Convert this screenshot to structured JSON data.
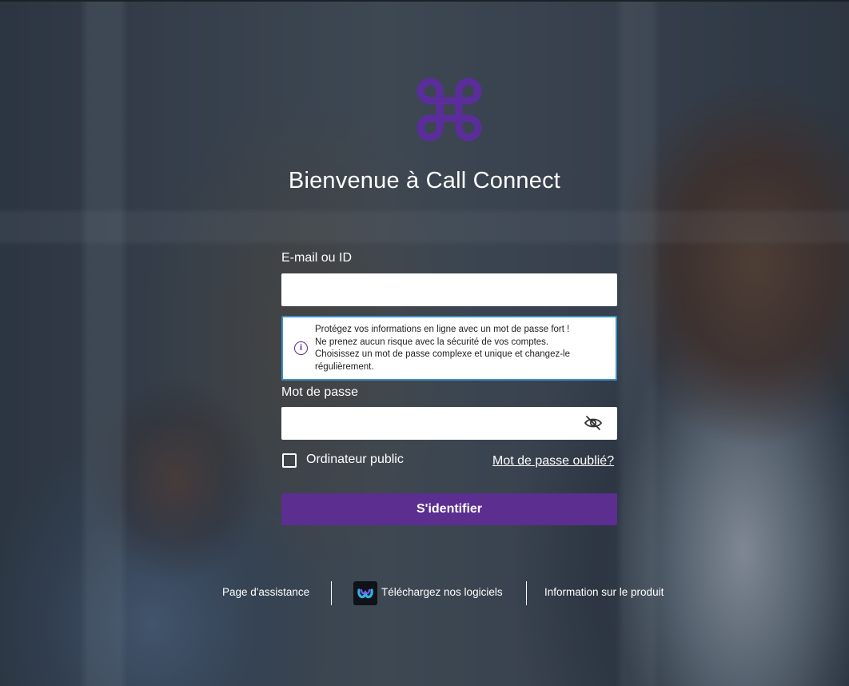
{
  "header": {
    "title": "Bienvenue à Call Connect"
  },
  "login_form": {
    "email_label": "E-mail ou ID",
    "email_value": "",
    "password_label": "Mot de passe",
    "password_value": "",
    "password_tip": "Protégez vos informations en ligne avec un mot de passe fort ! Ne prenez aucun risque avec la sécurité de vos comptes. Choisissez un mot de passe complexe et unique et changez-le régulièrement.",
    "public_computer_label": "Ordinateur public",
    "public_computer_checked": false,
    "forgot_password_label": "Mot de passe oublié?",
    "signin_label": "S'identifier"
  },
  "footer": {
    "support_label": "Page d'assistance",
    "download_label": "Téléchargez nos logiciels",
    "product_info_label": "Information sur le produit"
  },
  "icons": {
    "logo": "command-key-logo",
    "info": "info-icon",
    "password_visibility": "eye-slash-icon",
    "download": "webex-icon"
  },
  "colors": {
    "brand_purple": "#5b2e90",
    "logo_purple": "#5b2d9c",
    "tooltip_border": "#3a8fc7"
  }
}
